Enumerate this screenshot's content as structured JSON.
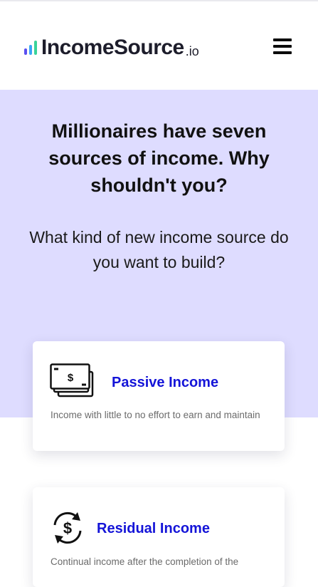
{
  "header": {
    "logo_main": "IncomeSource",
    "logo_suffix": ".io",
    "logo_bar_colors": [
      "#5a4ff0",
      "#3aa6f5",
      "#39d39a"
    ]
  },
  "hero": {
    "title": "Millionaires have seven sources of income. Why shouldn't you?",
    "subtitle": "What kind of new income source do you want to build?"
  },
  "cards": [
    {
      "title": "Passive Income",
      "description": "Income with little to no effort to earn and maintain",
      "icon": "cash-stack-icon"
    },
    {
      "title": "Residual Income",
      "description": "Continual income after the completion of the",
      "icon": "recurring-dollar-icon"
    }
  ],
  "colors": {
    "hero_bg": "#dedcff",
    "card_title": "#1414d8"
  }
}
